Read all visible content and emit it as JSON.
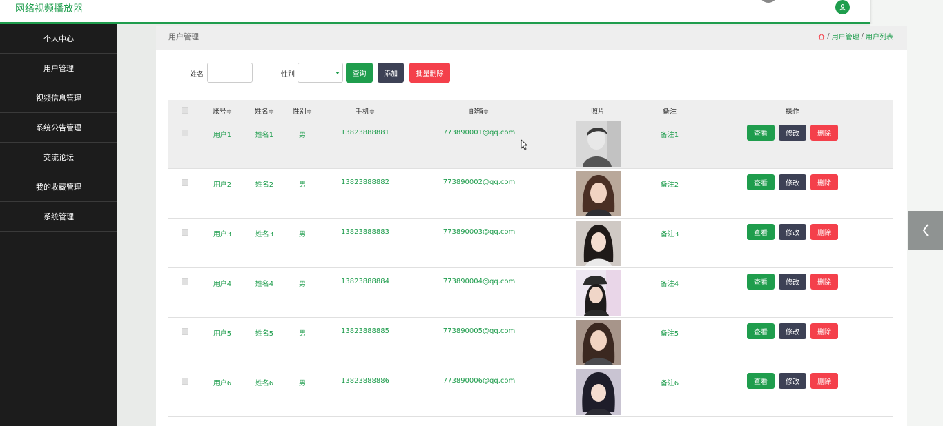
{
  "header": {
    "app_title": "网络视频播放器",
    "user_icon": "user-icon",
    "colors": {
      "brand": "#1f9d4d"
    }
  },
  "sidebar": {
    "items": [
      {
        "label": "个人中心"
      },
      {
        "label": "用户管理"
      },
      {
        "label": "视频信息管理"
      },
      {
        "label": "系统公告管理"
      },
      {
        "label": "交流论坛"
      },
      {
        "label": "我的收藏管理"
      },
      {
        "label": "系统管理"
      }
    ]
  },
  "page": {
    "heading": "用户管理",
    "breadcrumb": [
      "用户管理",
      "用户列表"
    ],
    "breadcrumb_sep": "/"
  },
  "search": {
    "name_label": "姓名",
    "name_value": "",
    "gender_label": "性别",
    "gender_value": "",
    "query_label": "查询",
    "add_label": "添加",
    "batch_delete_label": "批量删除"
  },
  "table": {
    "columns": [
      "账号",
      "姓名",
      "性别",
      "手机",
      "邮箱",
      "照片",
      "备注",
      "操作"
    ],
    "sort_mark": "≑",
    "rows": [
      {
        "account": "用户1",
        "name": "姓名1",
        "gender": "男",
        "phone": "13823888881",
        "email": "773890001@qq.com",
        "note": "备注1"
      },
      {
        "account": "用户2",
        "name": "姓名2",
        "gender": "男",
        "phone": "13823888882",
        "email": "773890002@qq.com",
        "note": "备注2"
      },
      {
        "account": "用户3",
        "name": "姓名3",
        "gender": "男",
        "phone": "13823888883",
        "email": "773890003@qq.com",
        "note": "备注3"
      },
      {
        "account": "用户4",
        "name": "姓名4",
        "gender": "男",
        "phone": "13823888884",
        "email": "773890004@qq.com",
        "note": "备注4"
      },
      {
        "account": "用户5",
        "name": "姓名5",
        "gender": "男",
        "phone": "13823888885",
        "email": "773890005@qq.com",
        "note": "备注5"
      },
      {
        "account": "用户6",
        "name": "姓名6",
        "gender": "男",
        "phone": "13823888886",
        "email": "773890006@qq.com",
        "note": "备注6"
      }
    ],
    "actions": {
      "view": "查看",
      "edit": "修改",
      "delete": "删除"
    }
  }
}
